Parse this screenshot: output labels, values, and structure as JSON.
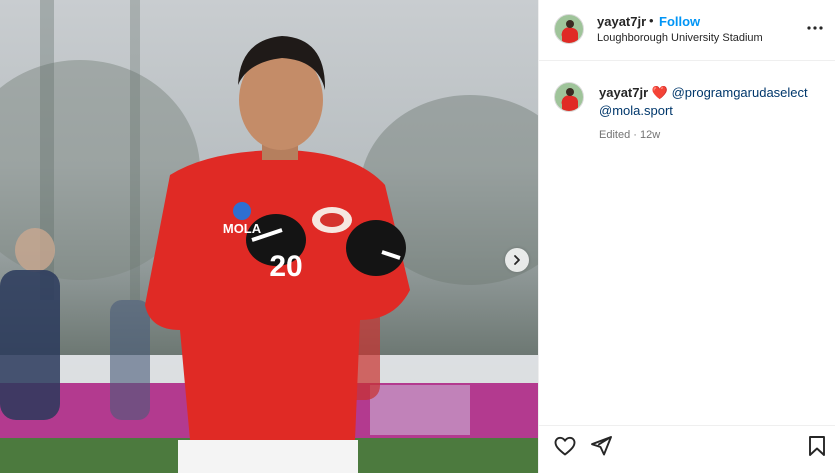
{
  "post": {
    "username": "yayat7jr",
    "separator": "•",
    "follow_label": "Follow",
    "location": "Loughborough University Stadium"
  },
  "caption": {
    "username": "yayat7jr",
    "emoji": "❤️",
    "mentions": [
      "@programgarudaselect",
      "@mola.sport"
    ],
    "meta": "Edited · 12w"
  },
  "photo": {
    "jersey_sponsor": "MOLA",
    "jersey_number": "20"
  },
  "icons": {
    "more": "more-options-icon",
    "next": "chevron-right-icon",
    "like": "heart-icon",
    "share": "paper-plane-icon",
    "save": "bookmark-icon"
  },
  "colors": {
    "accent": "#0095f6",
    "mention": "#00376b",
    "jersey": "#e02a25"
  }
}
